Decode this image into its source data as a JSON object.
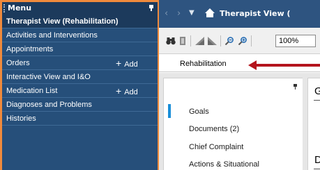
{
  "menu": {
    "title": "Menu",
    "items": [
      {
        "label": "Therapist View (Rehabilitation)",
        "selected": true
      },
      {
        "label": "Activities and Interventions"
      },
      {
        "label": "Appointments"
      },
      {
        "label": "Orders",
        "action": "Add"
      },
      {
        "label": "Interactive View and I&O"
      },
      {
        "label": "Medication List",
        "action": "Add"
      },
      {
        "label": "Diagnoses and Problems"
      },
      {
        "label": "Histories"
      }
    ]
  },
  "topbar": {
    "back_icon": "chevron-left-icon",
    "forward_icon": "chevron-right-icon",
    "dropdown_icon": "caret-down-icon",
    "home_icon": "home-icon",
    "title": "Therapist View ("
  },
  "toolbar": {
    "icons": [
      "binoculars-icon",
      "print-icon",
      "page-back-icon",
      "page-forward-icon",
      "zoom-out-icon",
      "zoom-in-icon"
    ],
    "zoom_value": "100%"
  },
  "tabs": {
    "active": "Rehabilitation"
  },
  "nav_panel": {
    "items": [
      "Goals",
      "Documents (2)",
      "Chief Complaint",
      "Actions & Situational"
    ]
  },
  "main_panel": {
    "heading_1": "G",
    "heading_2": "D"
  },
  "colors": {
    "menu_bg": "#264f7a",
    "menu_selected_bg": "#1c3a5c",
    "highlight_border": "#f08a3c",
    "topbar_bg": "#2e5480",
    "annotation_arrow": "#b4141c",
    "active_indicator": "#1a8ed8"
  }
}
